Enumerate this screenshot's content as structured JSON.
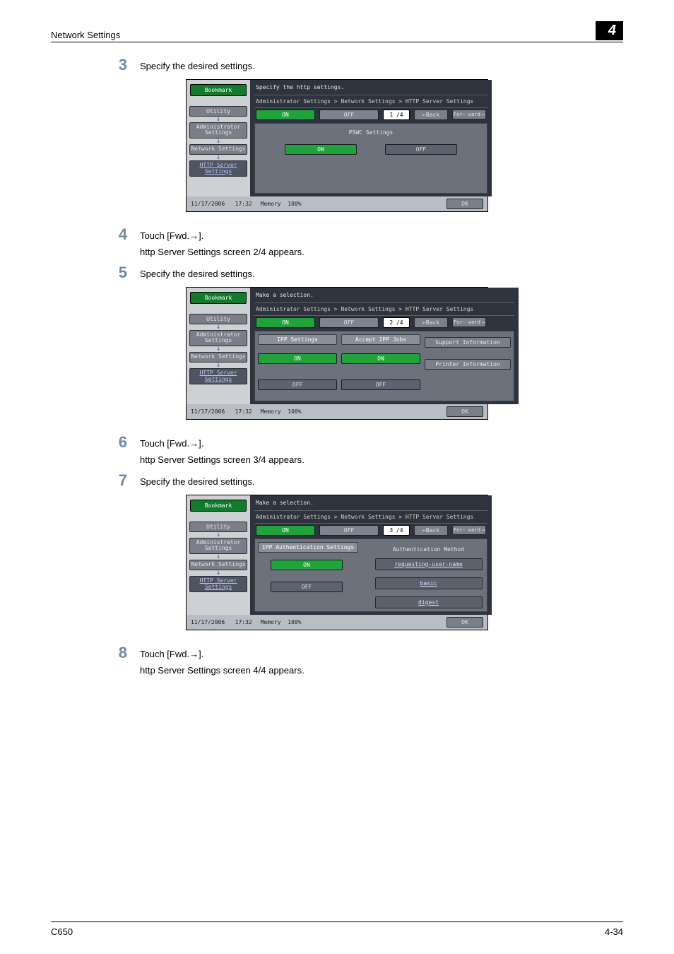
{
  "header": {
    "title": "Network Settings",
    "chapter": "4"
  },
  "steps": [
    {
      "num": "3",
      "text": "Specify the desired settings."
    },
    {
      "num": "4",
      "text": "Touch [Fwd.→].",
      "sub": "http Server Settings screen 2/4 appears."
    },
    {
      "num": "5",
      "text": "Specify the desired settings."
    },
    {
      "num": "6",
      "text": "Touch [Fwd.→].",
      "sub": "http Server Settings screen 3/4 appears."
    },
    {
      "num": "7",
      "text": "Specify the desired settings."
    },
    {
      "num": "8",
      "text": "Touch [Fwd.→].",
      "sub": "http Server Settings screen 4/4 appears."
    }
  ],
  "sidebar": {
    "bookmark": "Bookmark",
    "items": [
      "Utility",
      "Administrator Settings",
      "Network Settings",
      "HTTP Server Settings"
    ]
  },
  "common": {
    "breadcrumb": "Administrator Settings > Network Settings > HTTP Server Settings",
    "on": "ON",
    "off": "OFF",
    "back": "←Back",
    "fwd": "For- ward",
    "ok": "OK",
    "date": "11/17/2006",
    "time": "17:32",
    "memory": "Memory",
    "memval": "100%"
  },
  "screen1": {
    "instr": "Specify the http settings.",
    "page": "1 /4",
    "section": "PSWC Settings"
  },
  "screen2": {
    "instr": "Make a selection.",
    "page": "2 /4",
    "col1": "IPP Settings",
    "col2": "Accept IPP Jobs",
    "support": "Support Information",
    "printer": "Printer Information"
  },
  "screen3": {
    "instr": "Make a selection.",
    "page": "3 /4",
    "left_header": "IPP Authentication Settings",
    "right_header": "Authentication Method",
    "methods": [
      "requesting-user-name",
      "basic",
      "digest"
    ]
  },
  "footer": {
    "left": "C650",
    "right": "4-34"
  }
}
